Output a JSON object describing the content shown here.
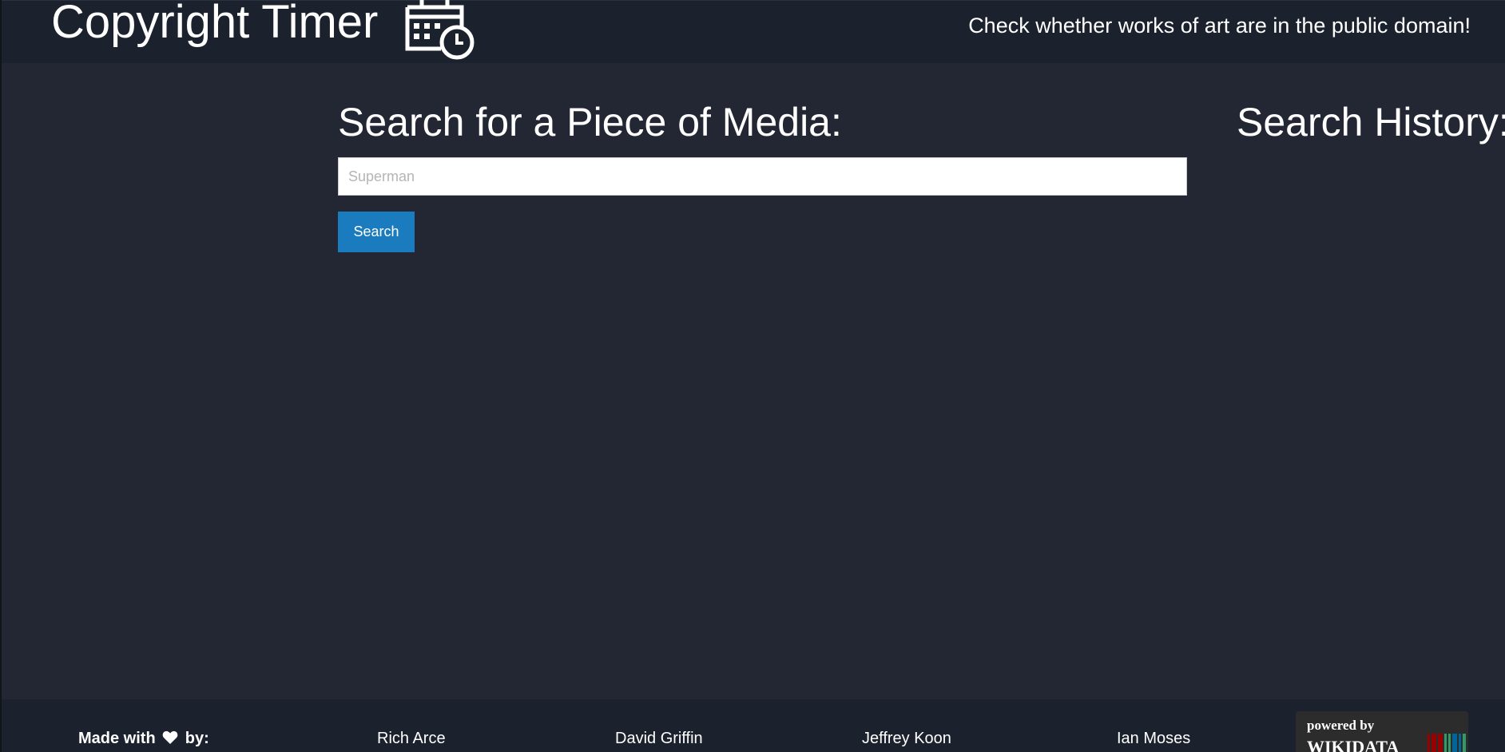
{
  "header": {
    "title": "Copyright Timer",
    "icon": "calendar-clock-icon",
    "tagline": "Check whether works of art are in the public domain!"
  },
  "search": {
    "heading": "Search for a Piece of Media:",
    "placeholder": "Superman",
    "value": "",
    "button_label": "Search"
  },
  "history": {
    "heading": "Search History:"
  },
  "footer": {
    "made_with_prefix": "Made with",
    "made_with_suffix": "by:",
    "heart_icon": "heart-icon",
    "authors": [
      "Rich Arce",
      "David Griffin",
      "Jeffrey Koon",
      "Ian Moses"
    ],
    "badge_powered": "powered by",
    "badge_name": "WIKIDATA"
  },
  "colors": {
    "background": "#232734",
    "header_bg": "#1b222d",
    "button_bg": "#1a7bbf",
    "text": "#ffffff"
  }
}
